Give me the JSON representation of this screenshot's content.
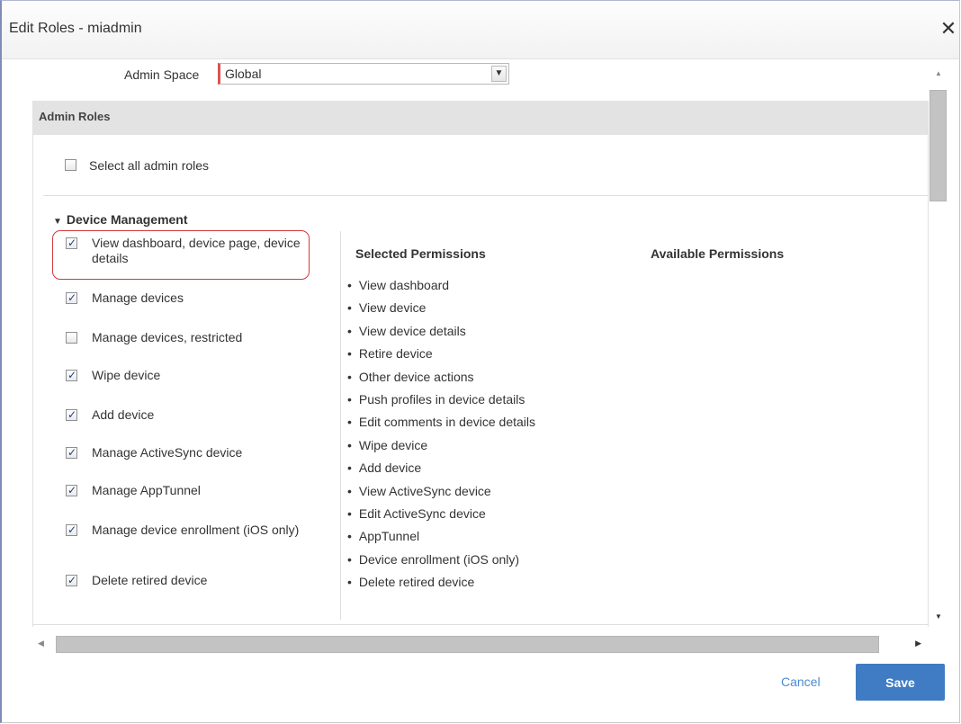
{
  "dialog": {
    "title": "Edit Roles - miadmin",
    "close_glyph": "✕"
  },
  "admin_space": {
    "label": "Admin Space",
    "selected": "Global",
    "arrow_glyph": "▼"
  },
  "admin_roles": {
    "header": "Admin Roles",
    "select_all_label": "Select all admin roles",
    "select_all_checked": false
  },
  "group": {
    "title": "Device Management",
    "toggle_glyph": "▼",
    "permissions": [
      {
        "label": "View dashboard, device page, device details",
        "checked": true
      },
      {
        "label": "Manage devices",
        "checked": true
      },
      {
        "label": "Manage devices, restricted",
        "checked": false
      },
      {
        "label": "Wipe device",
        "checked": true
      },
      {
        "label": "Add device",
        "checked": true
      },
      {
        "label": "Manage ActiveSync device",
        "checked": true
      },
      {
        "label": "Manage AppTunnel",
        "checked": true
      },
      {
        "label": "Manage device enrollment (iOS only)",
        "checked": true
      },
      {
        "label": "Delete retired device",
        "checked": true
      }
    ]
  },
  "columns": {
    "selected_title": "Selected Permissions",
    "available_title": "Available Permissions",
    "selected_items": [
      "View dashboard",
      "View device",
      "View device details",
      "Retire device",
      "Other device actions",
      "Push profiles in device details",
      "Edit comments in device details",
      "Wipe device",
      "Add device",
      "View ActiveSync device",
      "Edit ActiveSync device",
      "AppTunnel",
      "Device enrollment (iOS only)",
      "Delete retired device"
    ]
  },
  "scroll": {
    "up_glyph": "▲",
    "down_glyph": "▼",
    "left_glyph": "◀",
    "right_glyph": "▶"
  },
  "footer": {
    "cancel_label": "Cancel",
    "save_label": "Save"
  },
  "colors": {
    "accent": "#3f7cc3",
    "link": "#4a8ad4",
    "highlight": "#d23a3a"
  }
}
